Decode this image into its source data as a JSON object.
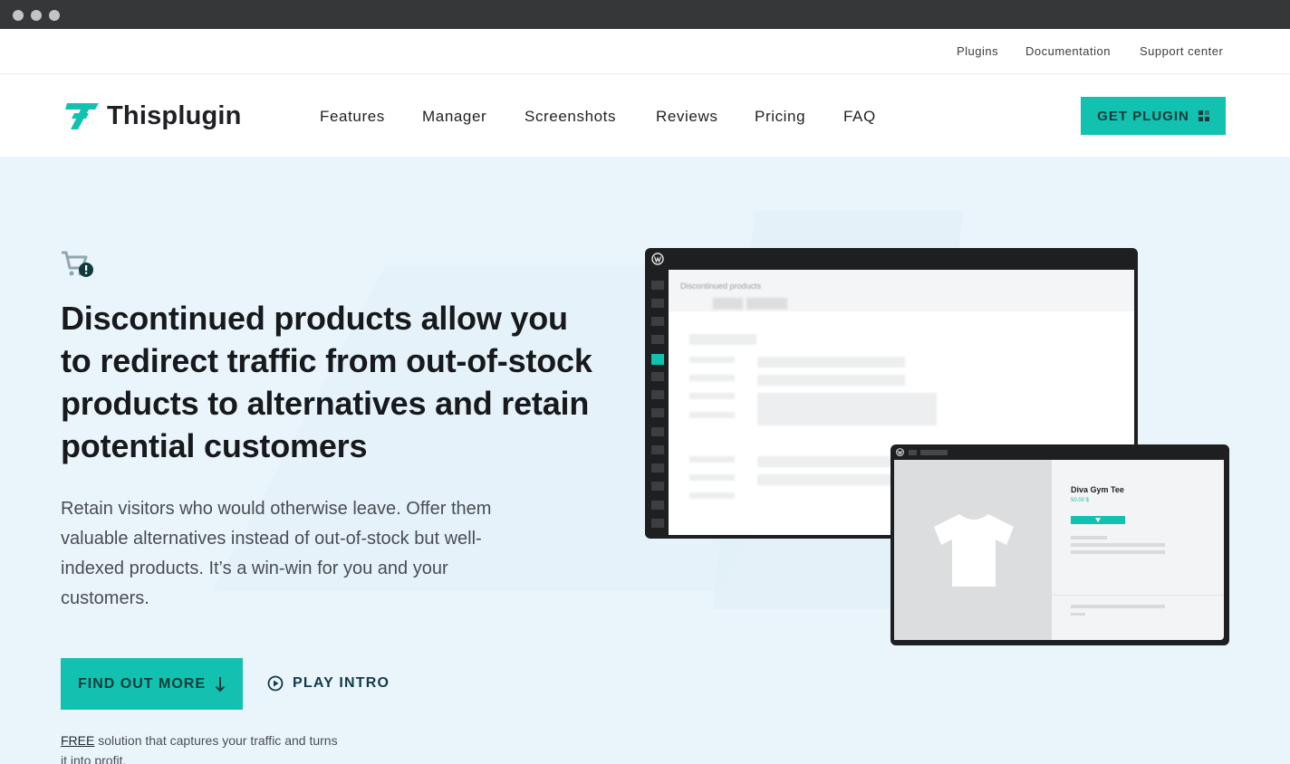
{
  "topbar": {
    "links": [
      "Plugins",
      "Documentation",
      "Support center"
    ]
  },
  "nav": {
    "brand": "Thisplugin",
    "items": [
      "Features",
      "Manager",
      "Screenshots",
      "Reviews",
      "Pricing",
      "FAQ"
    ],
    "cta_label": "GET PLUGIN"
  },
  "hero": {
    "heading": "Discontinued products allow you to redirect traffic from out-of-stock products to alternatives and retain potential customers",
    "lead": "Retain visitors who would otherwise leave. Offer them valuable alternatives instead of out-of-stock but well-indexed products. It’s a win-win for you and your customers.",
    "primary_cta": "FIND OUT MORE",
    "secondary_cta": "PLAY INTRO",
    "free_link": "FREE",
    "free_text": " solution that captures your traffic and turns it into profit."
  },
  "mockup": {
    "admin_title": "Discontinued products",
    "product_name": "Diva Gym Tee",
    "product_price": "50.00 $"
  },
  "colors": {
    "accent": "#13c1b1",
    "hero_bg": "#eaf5fb",
    "dark": "#1d1f21"
  },
  "icons": {
    "hero_icon": "cart-alert-icon",
    "cta_icon": "arrow-down-icon",
    "play_icon": "play-circle-icon",
    "nav_cta_icon": "grid-icon"
  }
}
